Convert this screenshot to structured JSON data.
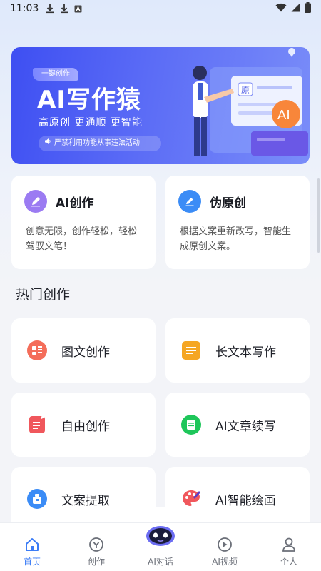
{
  "status_bar": {
    "time": "11:03"
  },
  "banner": {
    "tag": "一键创作",
    "title": "AI写作猿",
    "subtitle": "高原创 更通顺 更智能",
    "notice": "严禁利用功能从事违法活动",
    "doc_char": "原",
    "ai_badge": "AI"
  },
  "features": [
    {
      "title": "AI创作",
      "desc": "创意无限，创作轻松，轻松驾驭文笔！",
      "icon": "pen-icon",
      "color": "#9b7bf2"
    },
    {
      "title": "伪原创",
      "desc": "根据文案重新改写，智能生成原创文案。",
      "icon": "pencil-icon",
      "color": "#3b8cf6"
    }
  ],
  "section_title": "热门创作",
  "hot_items": [
    {
      "label": "图文创作",
      "icon": "image-text-icon",
      "color": "#f46d5a"
    },
    {
      "label": "长文本写作",
      "icon": "long-text-icon",
      "color": "#f5a623"
    },
    {
      "label": "自由创作",
      "icon": "free-write-icon",
      "color": "#f0575c"
    },
    {
      "label": "AI文章续写",
      "icon": "article-continue-icon",
      "color": "#1ec65a"
    },
    {
      "label": "文案提取",
      "icon": "extract-icon",
      "color": "#3b8cf6"
    },
    {
      "label": "AI智能绘画",
      "icon": "palette-icon",
      "color": "#f0575c"
    }
  ],
  "tabs": [
    {
      "label": "首页",
      "icon": "home-icon",
      "active": true
    },
    {
      "label": "创作",
      "icon": "create-icon",
      "active": false
    },
    {
      "label": "AI对话",
      "icon": "robot-icon",
      "active": false
    },
    {
      "label": "AI视频",
      "icon": "video-icon",
      "active": false
    },
    {
      "label": "个人",
      "icon": "user-icon",
      "active": false
    }
  ],
  "colors": {
    "accent": "#3b7cf6",
    "banner": "#4a5cf4"
  }
}
